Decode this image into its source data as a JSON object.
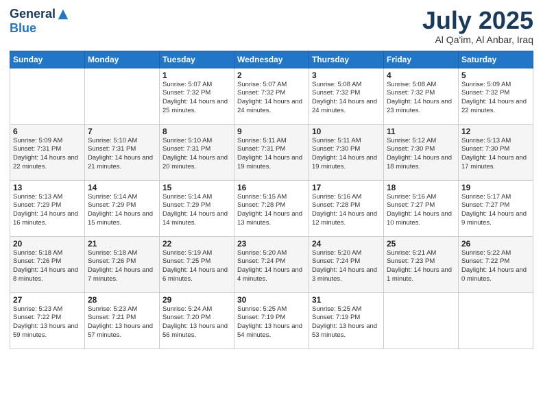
{
  "logo": {
    "general": "General",
    "blue": "Blue"
  },
  "header": {
    "month": "July 2025",
    "location": "Al Qa'im, Al Anbar, Iraq"
  },
  "weekdays": [
    "Sunday",
    "Monday",
    "Tuesday",
    "Wednesday",
    "Thursday",
    "Friday",
    "Saturday"
  ],
  "weeks": [
    [
      {
        "day": "",
        "sunrise": "",
        "sunset": "",
        "daylight": ""
      },
      {
        "day": "",
        "sunrise": "",
        "sunset": "",
        "daylight": ""
      },
      {
        "day": "1",
        "sunrise": "Sunrise: 5:07 AM",
        "sunset": "Sunset: 7:32 PM",
        "daylight": "Daylight: 14 hours and 25 minutes."
      },
      {
        "day": "2",
        "sunrise": "Sunrise: 5:07 AM",
        "sunset": "Sunset: 7:32 PM",
        "daylight": "Daylight: 14 hours and 24 minutes."
      },
      {
        "day": "3",
        "sunrise": "Sunrise: 5:08 AM",
        "sunset": "Sunset: 7:32 PM",
        "daylight": "Daylight: 14 hours and 24 minutes."
      },
      {
        "day": "4",
        "sunrise": "Sunrise: 5:08 AM",
        "sunset": "Sunset: 7:32 PM",
        "daylight": "Daylight: 14 hours and 23 minutes."
      },
      {
        "day": "5",
        "sunrise": "Sunrise: 5:09 AM",
        "sunset": "Sunset: 7:32 PM",
        "daylight": "Daylight: 14 hours and 22 minutes."
      }
    ],
    [
      {
        "day": "6",
        "sunrise": "Sunrise: 5:09 AM",
        "sunset": "Sunset: 7:31 PM",
        "daylight": "Daylight: 14 hours and 22 minutes."
      },
      {
        "day": "7",
        "sunrise": "Sunrise: 5:10 AM",
        "sunset": "Sunset: 7:31 PM",
        "daylight": "Daylight: 14 hours and 21 minutes."
      },
      {
        "day": "8",
        "sunrise": "Sunrise: 5:10 AM",
        "sunset": "Sunset: 7:31 PM",
        "daylight": "Daylight: 14 hours and 20 minutes."
      },
      {
        "day": "9",
        "sunrise": "Sunrise: 5:11 AM",
        "sunset": "Sunset: 7:31 PM",
        "daylight": "Daylight: 14 hours and 19 minutes."
      },
      {
        "day": "10",
        "sunrise": "Sunrise: 5:11 AM",
        "sunset": "Sunset: 7:30 PM",
        "daylight": "Daylight: 14 hours and 19 minutes."
      },
      {
        "day": "11",
        "sunrise": "Sunrise: 5:12 AM",
        "sunset": "Sunset: 7:30 PM",
        "daylight": "Daylight: 14 hours and 18 minutes."
      },
      {
        "day": "12",
        "sunrise": "Sunrise: 5:13 AM",
        "sunset": "Sunset: 7:30 PM",
        "daylight": "Daylight: 14 hours and 17 minutes."
      }
    ],
    [
      {
        "day": "13",
        "sunrise": "Sunrise: 5:13 AM",
        "sunset": "Sunset: 7:29 PM",
        "daylight": "Daylight: 14 hours and 16 minutes."
      },
      {
        "day": "14",
        "sunrise": "Sunrise: 5:14 AM",
        "sunset": "Sunset: 7:29 PM",
        "daylight": "Daylight: 14 hours and 15 minutes."
      },
      {
        "day": "15",
        "sunrise": "Sunrise: 5:14 AM",
        "sunset": "Sunset: 7:29 PM",
        "daylight": "Daylight: 14 hours and 14 minutes."
      },
      {
        "day": "16",
        "sunrise": "Sunrise: 5:15 AM",
        "sunset": "Sunset: 7:28 PM",
        "daylight": "Daylight: 14 hours and 13 minutes."
      },
      {
        "day": "17",
        "sunrise": "Sunrise: 5:16 AM",
        "sunset": "Sunset: 7:28 PM",
        "daylight": "Daylight: 14 hours and 12 minutes."
      },
      {
        "day": "18",
        "sunrise": "Sunrise: 5:16 AM",
        "sunset": "Sunset: 7:27 PM",
        "daylight": "Daylight: 14 hours and 10 minutes."
      },
      {
        "day": "19",
        "sunrise": "Sunrise: 5:17 AM",
        "sunset": "Sunset: 7:27 PM",
        "daylight": "Daylight: 14 hours and 9 minutes."
      }
    ],
    [
      {
        "day": "20",
        "sunrise": "Sunrise: 5:18 AM",
        "sunset": "Sunset: 7:26 PM",
        "daylight": "Daylight: 14 hours and 8 minutes."
      },
      {
        "day": "21",
        "sunrise": "Sunrise: 5:18 AM",
        "sunset": "Sunset: 7:26 PM",
        "daylight": "Daylight: 14 hours and 7 minutes."
      },
      {
        "day": "22",
        "sunrise": "Sunrise: 5:19 AM",
        "sunset": "Sunset: 7:25 PM",
        "daylight": "Daylight: 14 hours and 6 minutes."
      },
      {
        "day": "23",
        "sunrise": "Sunrise: 5:20 AM",
        "sunset": "Sunset: 7:24 PM",
        "daylight": "Daylight: 14 hours and 4 minutes."
      },
      {
        "day": "24",
        "sunrise": "Sunrise: 5:20 AM",
        "sunset": "Sunset: 7:24 PM",
        "daylight": "Daylight: 14 hours and 3 minutes."
      },
      {
        "day": "25",
        "sunrise": "Sunrise: 5:21 AM",
        "sunset": "Sunset: 7:23 PM",
        "daylight": "Daylight: 14 hours and 1 minute."
      },
      {
        "day": "26",
        "sunrise": "Sunrise: 5:22 AM",
        "sunset": "Sunset: 7:22 PM",
        "daylight": "Daylight: 14 hours and 0 minutes."
      }
    ],
    [
      {
        "day": "27",
        "sunrise": "Sunrise: 5:23 AM",
        "sunset": "Sunset: 7:22 PM",
        "daylight": "Daylight: 13 hours and 59 minutes."
      },
      {
        "day": "28",
        "sunrise": "Sunrise: 5:23 AM",
        "sunset": "Sunset: 7:21 PM",
        "daylight": "Daylight: 13 hours and 57 minutes."
      },
      {
        "day": "29",
        "sunrise": "Sunrise: 5:24 AM",
        "sunset": "Sunset: 7:20 PM",
        "daylight": "Daylight: 13 hours and 56 minutes."
      },
      {
        "day": "30",
        "sunrise": "Sunrise: 5:25 AM",
        "sunset": "Sunset: 7:19 PM",
        "daylight": "Daylight: 13 hours and 54 minutes."
      },
      {
        "day": "31",
        "sunrise": "Sunrise: 5:25 AM",
        "sunset": "Sunset: 7:19 PM",
        "daylight": "Daylight: 13 hours and 53 minutes."
      },
      {
        "day": "",
        "sunrise": "",
        "sunset": "",
        "daylight": ""
      },
      {
        "day": "",
        "sunrise": "",
        "sunset": "",
        "daylight": ""
      }
    ]
  ]
}
